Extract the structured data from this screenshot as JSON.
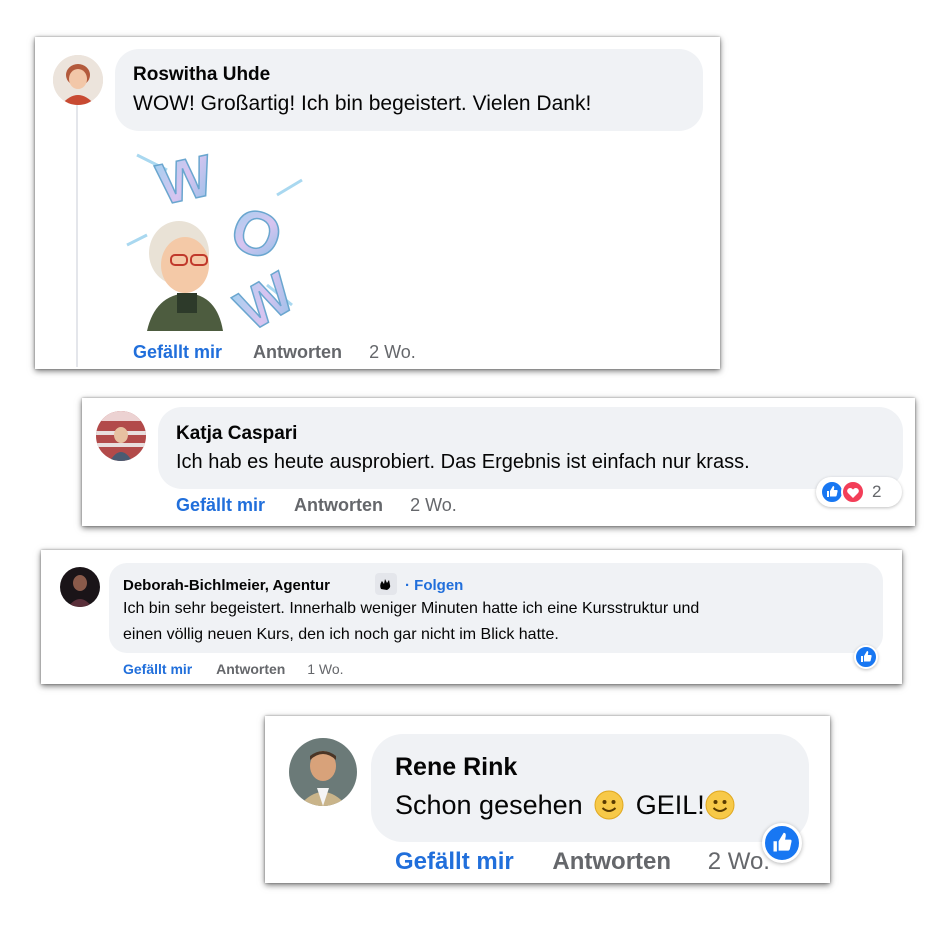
{
  "comments": [
    {
      "author": "Roswitha Uhde",
      "text": "WOW! Großartig! Ich bin begeistert. Vielen Dank!",
      "like_label": "Gefällt mir",
      "reply_label": "Antworten",
      "time": "2 Wo.",
      "sticker_text": "WOW"
    },
    {
      "author": "Katja Caspari",
      "text": "Ich hab es heute ausprobiert. Das Ergebnis ist einfach nur krass.",
      "like_label": "Gefällt mir",
      "reply_label": "Antworten",
      "time": "2 Wo.",
      "reaction_count": "2"
    },
    {
      "author": "Deborah-Bichlmeier, Agentur",
      "follow_label": "· Folgen",
      "text_line1": "Ich bin sehr begeistert. Innerhalb weniger Minuten hatte ich eine Kursstruktur und",
      "text_line2": "einen völlig neuen Kurs, den ich noch gar nicht im Blick hatte.",
      "like_label": "Gefällt mir",
      "reply_label": "Antworten",
      "time": "1 Wo."
    },
    {
      "author": "Rene Rink",
      "text_part1": "Schon gesehen",
      "text_part2": "GEIL!",
      "like_label": "Gefällt mir",
      "reply_label": "Antworten",
      "time": "2 Wo."
    }
  ],
  "colors": {
    "link_blue": "#216fdb",
    "muted_gray": "#65676b",
    "bubble_bg": "#f0f2f5",
    "like_blue": "#1877f2",
    "love_red": "#f33e58"
  }
}
